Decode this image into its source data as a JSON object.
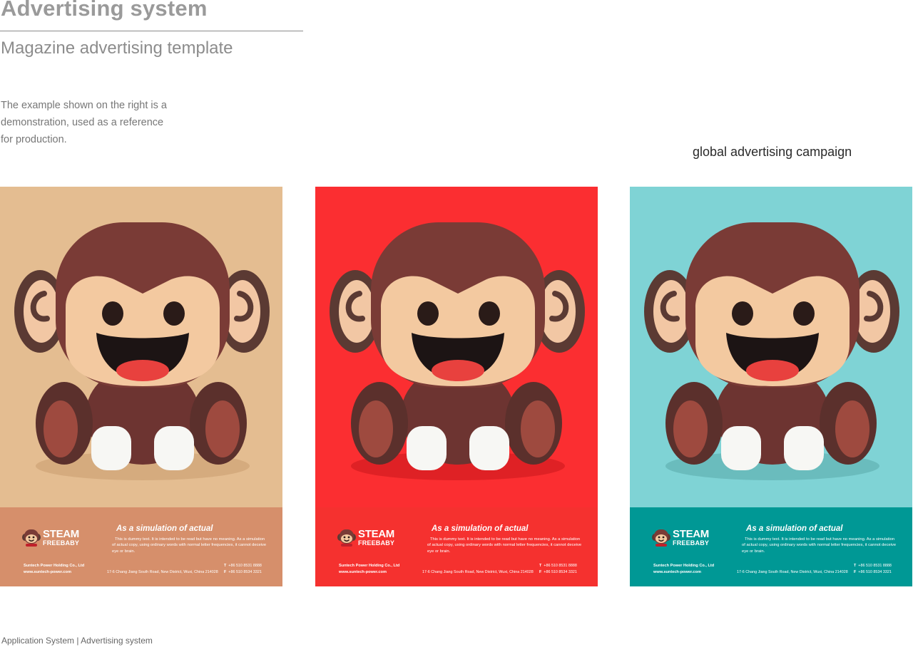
{
  "header": {
    "title": "Advertising system",
    "subtitle": "Magazine advertising template",
    "intro_line1": "The example shown on the right is a",
    "intro_line2": "demonstration, used as a reference",
    "intro_line3": "for production."
  },
  "campaign_label": "global advertising campaign",
  "ad": {
    "brand_name": "STEAM",
    "brand_sub": "FREEBABY",
    "headline": "As a simulation of actual",
    "body": "This is dummy text. It is intended to be read but have no meaning. As a simulation of actual copy, using ordinary words with normal letter frequencies, it cannot deceive eye or brain.",
    "company": "Suntech Power Holding Co., Ltd",
    "website": "www.suntech-power.com",
    "address": "17-6 Chang Jiang South Road, New District, Wuxi, China 214028",
    "phone_label": "T",
    "phone": "+86 510 8531 8888",
    "fax_label": "F",
    "fax": "+86 510 8534 3321"
  },
  "posters": [
    {
      "variant": "beige",
      "background": "#e4bd91",
      "footer_color": "#d68f6b",
      "shadow": "#c99c6f"
    },
    {
      "variant": "red",
      "background": "#fb2e31",
      "footer_color": "#f5312f",
      "shadow": "#c8171b"
    },
    {
      "variant": "teal",
      "background": "#7fd3d5",
      "footer_color": "#009895",
      "shadow": "#5aa9aa"
    }
  ],
  "footer": {
    "text": "Application System  |  Advertising system"
  }
}
